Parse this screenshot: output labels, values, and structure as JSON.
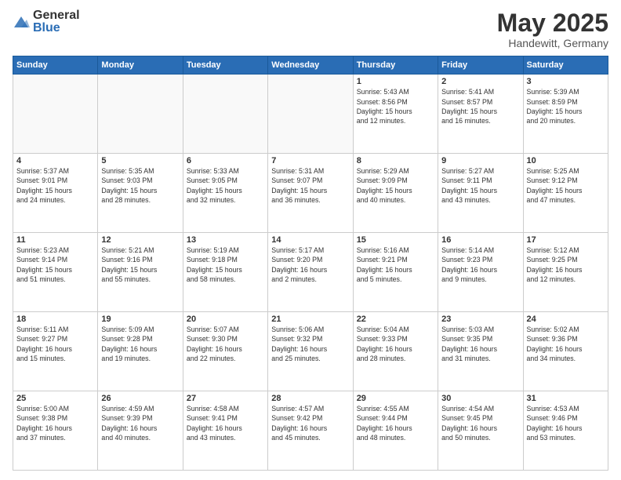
{
  "header": {
    "logo_general": "General",
    "logo_blue": "Blue",
    "title": "May 2025",
    "location": "Handewitt, Germany"
  },
  "days_of_week": [
    "Sunday",
    "Monday",
    "Tuesday",
    "Wednesday",
    "Thursday",
    "Friday",
    "Saturday"
  ],
  "weeks": [
    [
      {
        "day": "",
        "info": ""
      },
      {
        "day": "",
        "info": ""
      },
      {
        "day": "",
        "info": ""
      },
      {
        "day": "",
        "info": ""
      },
      {
        "day": "1",
        "info": "Sunrise: 5:43 AM\nSunset: 8:56 PM\nDaylight: 15 hours\nand 12 minutes."
      },
      {
        "day": "2",
        "info": "Sunrise: 5:41 AM\nSunset: 8:57 PM\nDaylight: 15 hours\nand 16 minutes."
      },
      {
        "day": "3",
        "info": "Sunrise: 5:39 AM\nSunset: 8:59 PM\nDaylight: 15 hours\nand 20 minutes."
      }
    ],
    [
      {
        "day": "4",
        "info": "Sunrise: 5:37 AM\nSunset: 9:01 PM\nDaylight: 15 hours\nand 24 minutes."
      },
      {
        "day": "5",
        "info": "Sunrise: 5:35 AM\nSunset: 9:03 PM\nDaylight: 15 hours\nand 28 minutes."
      },
      {
        "day": "6",
        "info": "Sunrise: 5:33 AM\nSunset: 9:05 PM\nDaylight: 15 hours\nand 32 minutes."
      },
      {
        "day": "7",
        "info": "Sunrise: 5:31 AM\nSunset: 9:07 PM\nDaylight: 15 hours\nand 36 minutes."
      },
      {
        "day": "8",
        "info": "Sunrise: 5:29 AM\nSunset: 9:09 PM\nDaylight: 15 hours\nand 40 minutes."
      },
      {
        "day": "9",
        "info": "Sunrise: 5:27 AM\nSunset: 9:11 PM\nDaylight: 15 hours\nand 43 minutes."
      },
      {
        "day": "10",
        "info": "Sunrise: 5:25 AM\nSunset: 9:12 PM\nDaylight: 15 hours\nand 47 minutes."
      }
    ],
    [
      {
        "day": "11",
        "info": "Sunrise: 5:23 AM\nSunset: 9:14 PM\nDaylight: 15 hours\nand 51 minutes."
      },
      {
        "day": "12",
        "info": "Sunrise: 5:21 AM\nSunset: 9:16 PM\nDaylight: 15 hours\nand 55 minutes."
      },
      {
        "day": "13",
        "info": "Sunrise: 5:19 AM\nSunset: 9:18 PM\nDaylight: 15 hours\nand 58 minutes."
      },
      {
        "day": "14",
        "info": "Sunrise: 5:17 AM\nSunset: 9:20 PM\nDaylight: 16 hours\nand 2 minutes."
      },
      {
        "day": "15",
        "info": "Sunrise: 5:16 AM\nSunset: 9:21 PM\nDaylight: 16 hours\nand 5 minutes."
      },
      {
        "day": "16",
        "info": "Sunrise: 5:14 AM\nSunset: 9:23 PM\nDaylight: 16 hours\nand 9 minutes."
      },
      {
        "day": "17",
        "info": "Sunrise: 5:12 AM\nSunset: 9:25 PM\nDaylight: 16 hours\nand 12 minutes."
      }
    ],
    [
      {
        "day": "18",
        "info": "Sunrise: 5:11 AM\nSunset: 9:27 PM\nDaylight: 16 hours\nand 15 minutes."
      },
      {
        "day": "19",
        "info": "Sunrise: 5:09 AM\nSunset: 9:28 PM\nDaylight: 16 hours\nand 19 minutes."
      },
      {
        "day": "20",
        "info": "Sunrise: 5:07 AM\nSunset: 9:30 PM\nDaylight: 16 hours\nand 22 minutes."
      },
      {
        "day": "21",
        "info": "Sunrise: 5:06 AM\nSunset: 9:32 PM\nDaylight: 16 hours\nand 25 minutes."
      },
      {
        "day": "22",
        "info": "Sunrise: 5:04 AM\nSunset: 9:33 PM\nDaylight: 16 hours\nand 28 minutes."
      },
      {
        "day": "23",
        "info": "Sunrise: 5:03 AM\nSunset: 9:35 PM\nDaylight: 16 hours\nand 31 minutes."
      },
      {
        "day": "24",
        "info": "Sunrise: 5:02 AM\nSunset: 9:36 PM\nDaylight: 16 hours\nand 34 minutes."
      }
    ],
    [
      {
        "day": "25",
        "info": "Sunrise: 5:00 AM\nSunset: 9:38 PM\nDaylight: 16 hours\nand 37 minutes."
      },
      {
        "day": "26",
        "info": "Sunrise: 4:59 AM\nSunset: 9:39 PM\nDaylight: 16 hours\nand 40 minutes."
      },
      {
        "day": "27",
        "info": "Sunrise: 4:58 AM\nSunset: 9:41 PM\nDaylight: 16 hours\nand 43 minutes."
      },
      {
        "day": "28",
        "info": "Sunrise: 4:57 AM\nSunset: 9:42 PM\nDaylight: 16 hours\nand 45 minutes."
      },
      {
        "day": "29",
        "info": "Sunrise: 4:55 AM\nSunset: 9:44 PM\nDaylight: 16 hours\nand 48 minutes."
      },
      {
        "day": "30",
        "info": "Sunrise: 4:54 AM\nSunset: 9:45 PM\nDaylight: 16 hours\nand 50 minutes."
      },
      {
        "day": "31",
        "info": "Sunrise: 4:53 AM\nSunset: 9:46 PM\nDaylight: 16 hours\nand 53 minutes."
      }
    ]
  ]
}
